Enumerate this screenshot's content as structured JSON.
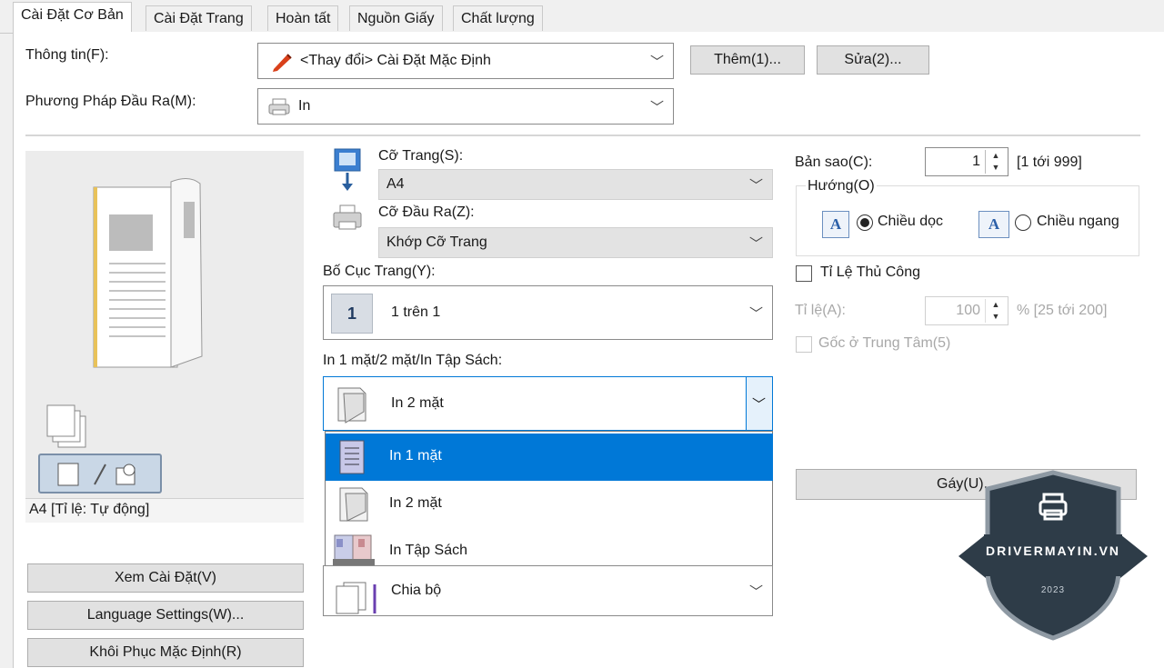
{
  "tabs": [
    "Cài Đặt Cơ Bản",
    "Cài Đặt Trang",
    "Hoàn tất",
    "Nguồn Giấy",
    "Chất lượng"
  ],
  "profile": {
    "label": "Thông tin(F):",
    "value": "<Thay đổi> Cài Đặt Mặc Định",
    "add_button": "Thêm(1)...",
    "edit_button": "Sửa(2)..."
  },
  "output_method": {
    "label": "Phương Pháp Đầu Ra(M):",
    "value": "In"
  },
  "preview": {
    "status": "A4 [Tỉ lệ: Tự động]"
  },
  "page_size": {
    "label": "Cỡ Trang(S):",
    "value": "A4"
  },
  "output_size": {
    "label": "Cỡ Đầu Ra(Z):",
    "value": "Khớp Cỡ Trang"
  },
  "page_layout": {
    "label": "Bố Cục Trang(Y):",
    "value": "1 trên 1",
    "icon_text": "1"
  },
  "duplex": {
    "label": "In 1 mặt/2 mặt/In Tập Sách:",
    "value": "In 2 mặt",
    "options": [
      "In 1 mặt",
      "In 2 mặt",
      "In Tập Sách"
    ],
    "selected_index": 0
  },
  "collate": {
    "value": "Chia bộ"
  },
  "copies": {
    "label": "Bản sao(C):",
    "value": "1",
    "range": "[1 tới 999]"
  },
  "orientation": {
    "label": "Hướng(O)",
    "portrait": "Chiều dọc",
    "landscape": "Chiều ngang",
    "icon_letter": "A"
  },
  "manual_scale": {
    "label": "Tỉ Lệ Thủ Công",
    "scale_label": "Tỉ lệ(A):",
    "scale_value": "100",
    "scale_range": "% [25 tới 200]",
    "center_label": "Gốc ở Trung Tâm(5)"
  },
  "staple_button": "Gáy(U)...",
  "left_buttons": [
    "Xem Cài Đặt(V)",
    "Language Settings(W)...",
    "Khôi Phục Mặc Định(R)"
  ],
  "watermark": {
    "text": "DRIVERMAYIN.VN",
    "year": "2023"
  },
  "colors": {
    "selected": "#0078d7",
    "shield": "#2e3c48",
    "shield_border": "#8e99a3"
  }
}
